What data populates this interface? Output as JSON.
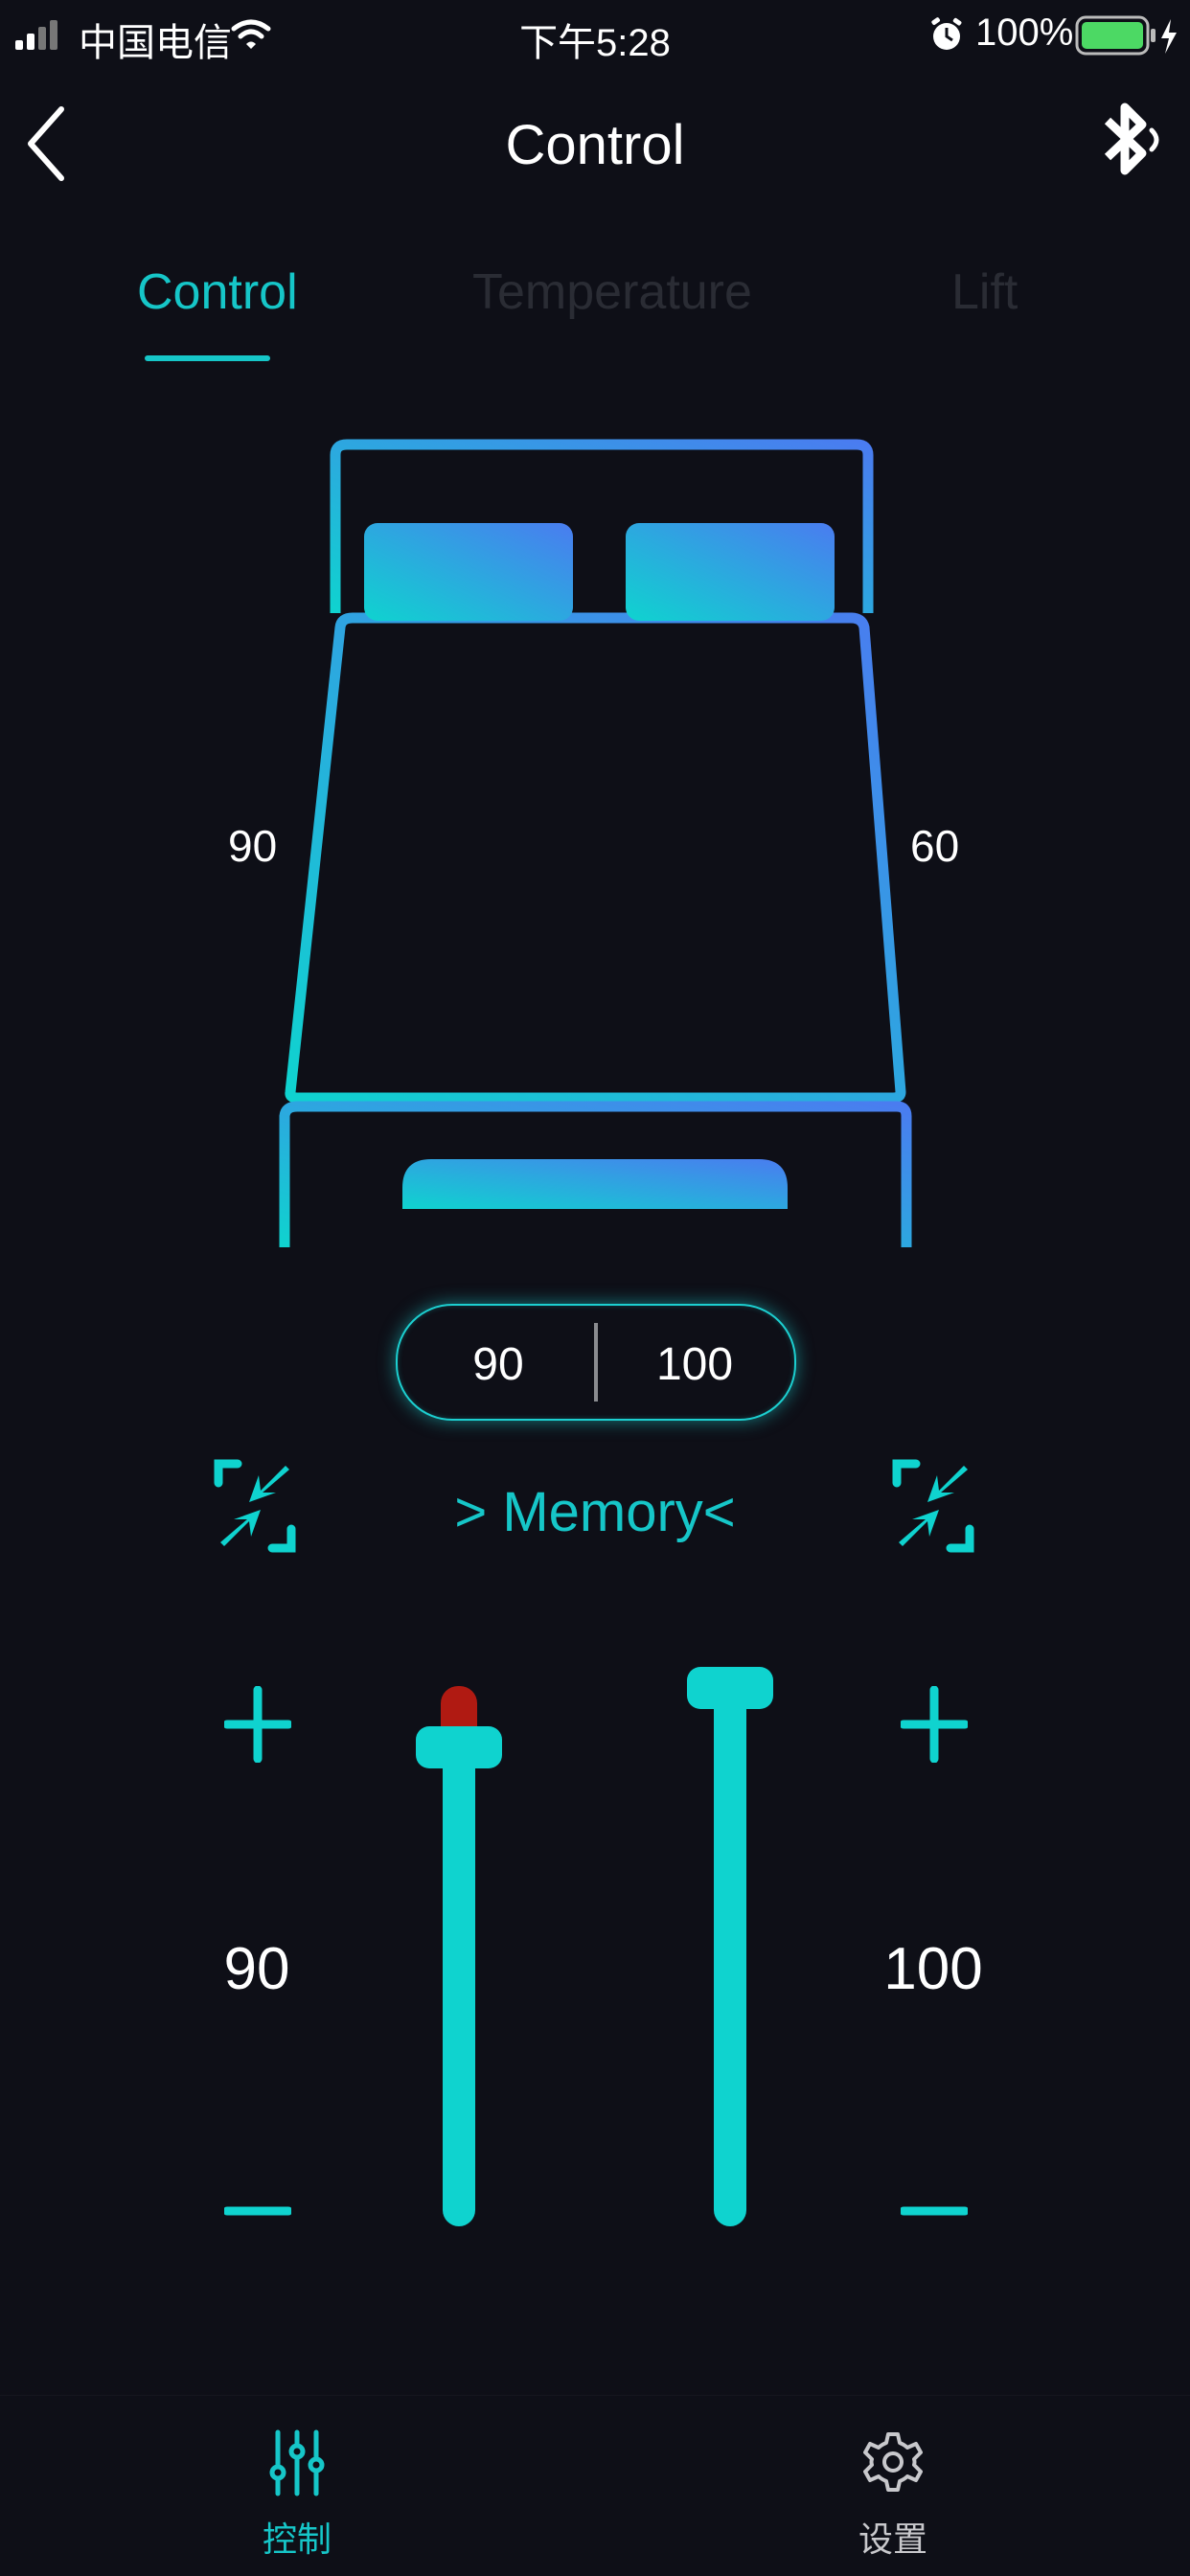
{
  "status_bar": {
    "carrier": "中国电信",
    "time": "下午5:28",
    "battery_percent": "100%"
  },
  "nav": {
    "title": "Control"
  },
  "tabs": [
    {
      "label": "Control",
      "active": true
    },
    {
      "label": "Temperature",
      "active": false
    },
    {
      "label": "Lift",
      "active": false
    }
  ],
  "bed": {
    "left_angle": "90",
    "right_angle": "60"
  },
  "pill": {
    "left_value": "90",
    "right_value": "100"
  },
  "memory_label": "> Memory<",
  "sliders": {
    "left": {
      "value": "90",
      "level": 0.9
    },
    "right": {
      "value": "100",
      "level": 1.0
    }
  },
  "tabbar": [
    {
      "label": "控制",
      "icon": "sliders-icon",
      "active": true
    },
    {
      "label": "设置",
      "icon": "gear-icon",
      "active": false
    }
  ],
  "colors": {
    "accent": "#16c6c8",
    "background": "#0e0f17",
    "bed_gradient_start": "#0fd3cf",
    "bed_gradient_end": "#4a7cf0",
    "indicator_red": "#b01a12"
  }
}
